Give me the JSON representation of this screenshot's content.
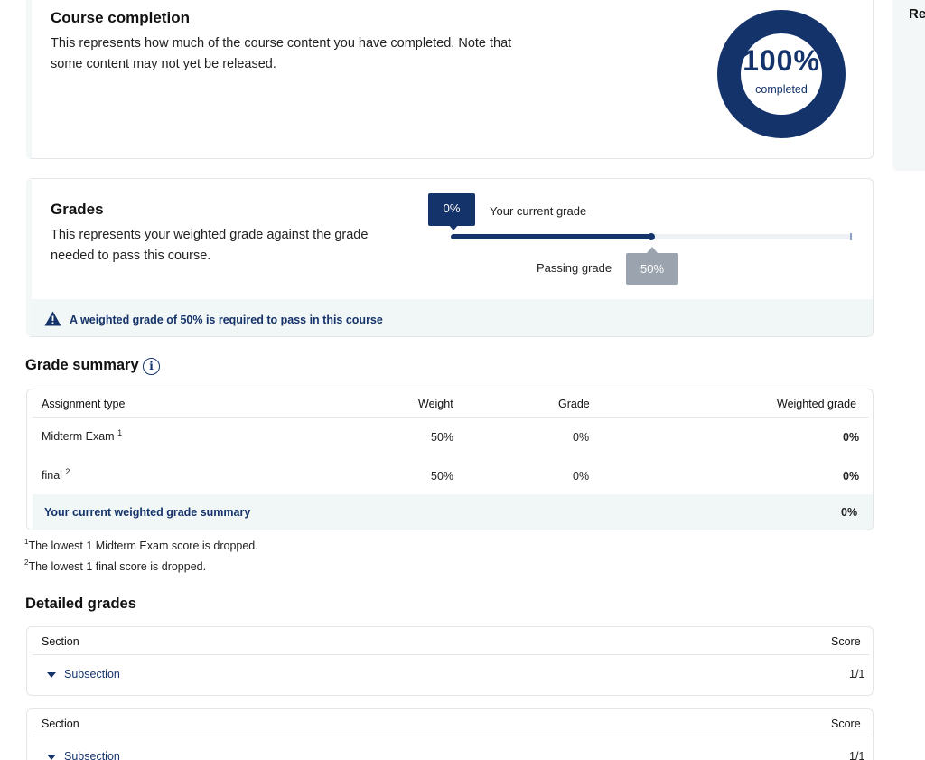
{
  "completion": {
    "title": "Course completion",
    "description": "This represents how much of the course content you have completed. Note that some content may not yet be released.",
    "percent": "100%",
    "percent_value": 100,
    "percent_label": "completed",
    "accent_color": "#15336b"
  },
  "grades": {
    "title": "Grades",
    "description": "This represents your weighted grade against the grade needed to pass this course.",
    "current_grade": "0%",
    "current_grade_value": 0,
    "current_grade_label": "Your current grade",
    "passing_grade": "50%",
    "passing_grade_value": 50,
    "passing_grade_label": "Passing grade",
    "alert_icon": "warning-triangle-icon",
    "alert_text": "A weighted grade of 50% is required to pass in this course"
  },
  "grade_summary": {
    "heading": "Grade summary",
    "info_icon": "info-circle-icon",
    "columns": [
      "Assignment type",
      "Weight",
      "Grade",
      "Weighted grade"
    ],
    "rows": [
      {
        "type": "Midterm Exam",
        "sup": "1",
        "weight": "50%",
        "grade": "0%",
        "weighted": "0%"
      },
      {
        "type": "final",
        "sup": "2",
        "weight": "50%",
        "grade": "0%",
        "weighted": "0%"
      }
    ],
    "footer_label": "Your current weighted grade summary",
    "footer_value": "0%",
    "footnotes": [
      {
        "sup": "1",
        "text": "The lowest 1 Midterm Exam score is dropped."
      },
      {
        "sup": "2",
        "text": "The lowest 1 final score is dropped."
      }
    ]
  },
  "detailed_grades": {
    "heading": "Detailed grades",
    "tables": [
      {
        "section_label": "Section",
        "score_label": "Score",
        "subsection": "Subsection",
        "score": "1/1"
      },
      {
        "section_label": "Section",
        "score_label": "Score",
        "subsection": "Subsection",
        "score": "1/1"
      }
    ]
  },
  "right_panel": {
    "title": "Re"
  }
}
